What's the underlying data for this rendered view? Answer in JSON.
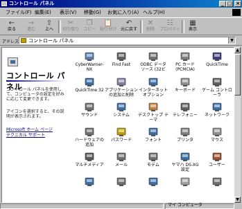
{
  "window": {
    "title": "コントロール パネル"
  },
  "title_buttons": {
    "minimize": "_",
    "maximize": "□",
    "close": "×"
  },
  "menu": [
    "ファイル(F)",
    "編集(E)",
    "表示(V)",
    "移動(G)",
    "お気に入り(A)",
    "ヘルプ(H)"
  ],
  "toolbar": [
    {
      "label": "戻る",
      "icon": "back-arrow-icon",
      "glyph": "←",
      "disabled": false
    },
    {
      "label": "進む",
      "icon": "forward-arrow-icon",
      "glyph": "→",
      "disabled": true
    },
    {
      "label": "上へ",
      "icon": "up-folder-icon",
      "glyph": "⇧",
      "disabled": false
    },
    {
      "label": "切り取り",
      "icon": "cut-icon",
      "glyph": "✂",
      "disabled": true
    },
    {
      "label": "コピー",
      "icon": "copy-icon",
      "glyph": "❐",
      "disabled": true
    },
    {
      "label": "貼り付け",
      "icon": "paste-icon",
      "glyph": "📋",
      "disabled": true
    },
    {
      "label": "元に戻す",
      "icon": "undo-icon",
      "glyph": "↶",
      "disabled": false
    },
    {
      "label": "削除",
      "icon": "delete-icon",
      "glyph": "✕",
      "disabled": true
    },
    {
      "label": "プロパティ",
      "icon": "properties-icon",
      "glyph": "☷",
      "disabled": true
    },
    {
      "label": "表示",
      "icon": "views-icon",
      "glyph": "▦",
      "disabled": false
    }
  ],
  "address": {
    "label": "アドレス(D)",
    "value": "コントロール パネル"
  },
  "left_pane": {
    "title": "コントロール パネル",
    "description": "コントロール パネルを使用して、コンピュータの設定を好みに応じて変更できます。",
    "hint": "アイコンを選択すると、その説明が表示されます。",
    "links": [
      "Microsoft ホーム ページ",
      "テクニカル サポート"
    ]
  },
  "items": [
    {
      "label": "CyberWarner-\nNX",
      "icon": "cyberwarner-icon",
      "color": "#5a7fb0"
    },
    {
      "label": "Find Fast",
      "icon": "find-fast-icon",
      "color": "#606060"
    },
    {
      "label": "ODBC データ\nソース (32ビ",
      "icon": "odbc-icon",
      "color": "#707070"
    },
    {
      "label": "PC カード\n(PCMCIA)",
      "icon": "pc-card-icon",
      "color": "#808080"
    },
    {
      "label": "QuickTime",
      "icon": "quicktime-icon",
      "color": "#404080"
    },
    {
      "label": "QuickTime 32",
      "icon": "quicktime32-icon",
      "color": "#3a6ea5"
    },
    {
      "label": "アプリケーション\nの追加と削除",
      "icon": "add-remove-programs-icon",
      "color": "#8080a0"
    },
    {
      "label": "インターネット\nオプション",
      "icon": "internet-options-icon",
      "color": "#3a6ea5"
    },
    {
      "label": "キーボード",
      "icon": "keyboard-icon",
      "color": "#909090"
    },
    {
      "label": "ゲーム コントロ\nーラ",
      "icon": "game-controllers-icon",
      "color": "#606060"
    },
    {
      "label": "サウンド",
      "icon": "sound-icon",
      "color": "#707070"
    },
    {
      "label": "システム",
      "icon": "system-icon",
      "color": "#3a6ea5"
    },
    {
      "label": "デスクトップ テ\nーマ",
      "icon": "desktop-themes-icon",
      "color": "#c08040"
    },
    {
      "label": "テレフォニー",
      "icon": "telephony-icon",
      "color": "#606060"
    },
    {
      "label": "ネットワーク",
      "icon": "network-icon",
      "color": "#3a6ea5"
    },
    {
      "label": "ハードウェアの\n追加",
      "icon": "add-hardware-icon",
      "color": "#707070"
    },
    {
      "label": "パスワード",
      "icon": "passwords-icon",
      "color": "#c0a000"
    },
    {
      "label": "フォント",
      "icon": "fonts-icon",
      "color": "#3a6ea5"
    },
    {
      "label": "プリンタ",
      "icon": "printers-icon",
      "color": "#808080"
    },
    {
      "label": "マウス",
      "icon": "mouse-icon",
      "color": "#909090"
    },
    {
      "label": "マルチメディア",
      "icon": "multimedia-icon",
      "color": "#5a5a5a"
    },
    {
      "label": "メール",
      "icon": "mail-icon",
      "color": "#707070"
    },
    {
      "label": "モデム",
      "icon": "modems-icon",
      "color": "#707070"
    },
    {
      "label": "ヤマハ DS-XG\n設定",
      "icon": "yamaha-ds-xg-icon",
      "color": "#3a6ea5"
    },
    {
      "label": "ユーザー",
      "icon": "users-icon",
      "color": "#a05030"
    },
    {
      "label": "",
      "icon": "accessibility-icon",
      "color": "#3a6ea5"
    },
    {
      "label": "",
      "icon": "regional-settings-icon",
      "color": "#707070"
    },
    {
      "label": "",
      "icon": "internet-globe-icon",
      "color": "#3a6ea5"
    },
    {
      "label": "",
      "icon": "date-time-icon",
      "color": "#a0a0a0"
    },
    {
      "label": "",
      "icon": "scheduled-tasks-icon",
      "color": "#707070"
    }
  ],
  "status": {
    "text": "マイ コンピュータ"
  }
}
